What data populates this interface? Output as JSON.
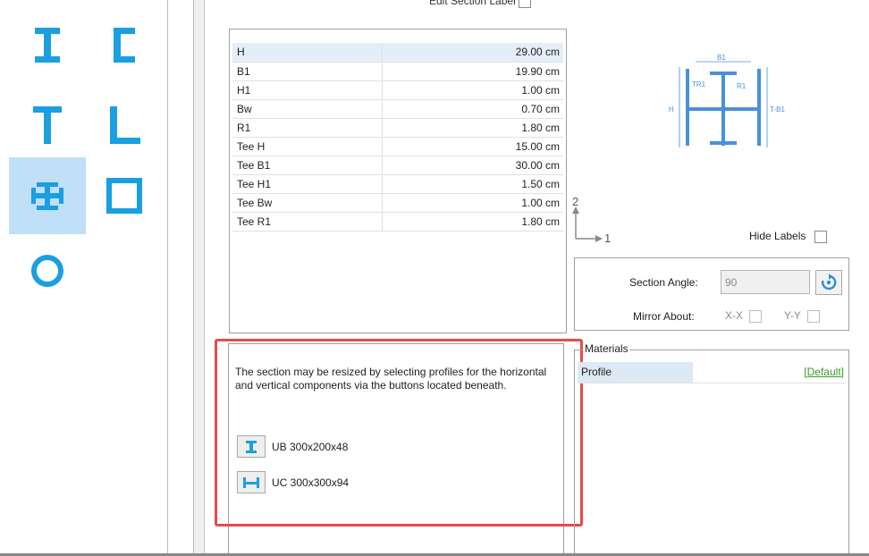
{
  "header": {
    "edit_section_label": "Edit Section Label"
  },
  "palette": {
    "shapes": [
      {
        "name": "i-section",
        "selected": false
      },
      {
        "name": "channel",
        "selected": false
      },
      {
        "name": "tee",
        "selected": false
      },
      {
        "name": "angle",
        "selected": false
      },
      {
        "name": "cruciform",
        "selected": true
      },
      {
        "name": "box",
        "selected": false
      },
      {
        "name": "circle",
        "selected": false
      }
    ]
  },
  "properties": {
    "rows": [
      {
        "key": "H",
        "value": "29.00 cm"
      },
      {
        "key": "B1",
        "value": "19.90 cm"
      },
      {
        "key": "H1",
        "value": "1.00 cm"
      },
      {
        "key": "Bw",
        "value": "0.70 cm"
      },
      {
        "key": "R1",
        "value": "1.80 cm"
      },
      {
        "key": "Tee H",
        "value": "15.00 cm"
      },
      {
        "key": "Tee B1",
        "value": "30.00 cm"
      },
      {
        "key": "Tee H1",
        "value": "1.50 cm"
      },
      {
        "key": "Tee Bw",
        "value": "1.00 cm"
      },
      {
        "key": "Tee R1",
        "value": "1.80 cm"
      }
    ]
  },
  "preview": {
    "labels": {
      "b1": "B1",
      "tr1": "TR1",
      "r1": "R1",
      "h": "H",
      "tb1": "T-B1"
    },
    "axis_2": "2",
    "axis_1": "1",
    "hide_labels": "Hide Labels"
  },
  "section": {
    "angle_label": "Section Angle:",
    "angle_value": "90",
    "mirror_label": "Mirror About:",
    "mirror_x": "X-X",
    "mirror_y": "Y-Y"
  },
  "description": {
    "text": "The section may be resized by selecting profiles for the horizontal and vertical components via the buttons located beneath.",
    "profile_vertical": "UB 300x200x48",
    "profile_horizontal": "UC 300x300x94"
  },
  "materials": {
    "title": "Materials",
    "profile_key": "Profile",
    "profile_value": "[Default]"
  },
  "colors": {
    "accent": "#1a9fe0",
    "selected_bg": "#bfe0f7",
    "highlight": "#e84a4a",
    "link_green": "#3a9a2e"
  }
}
